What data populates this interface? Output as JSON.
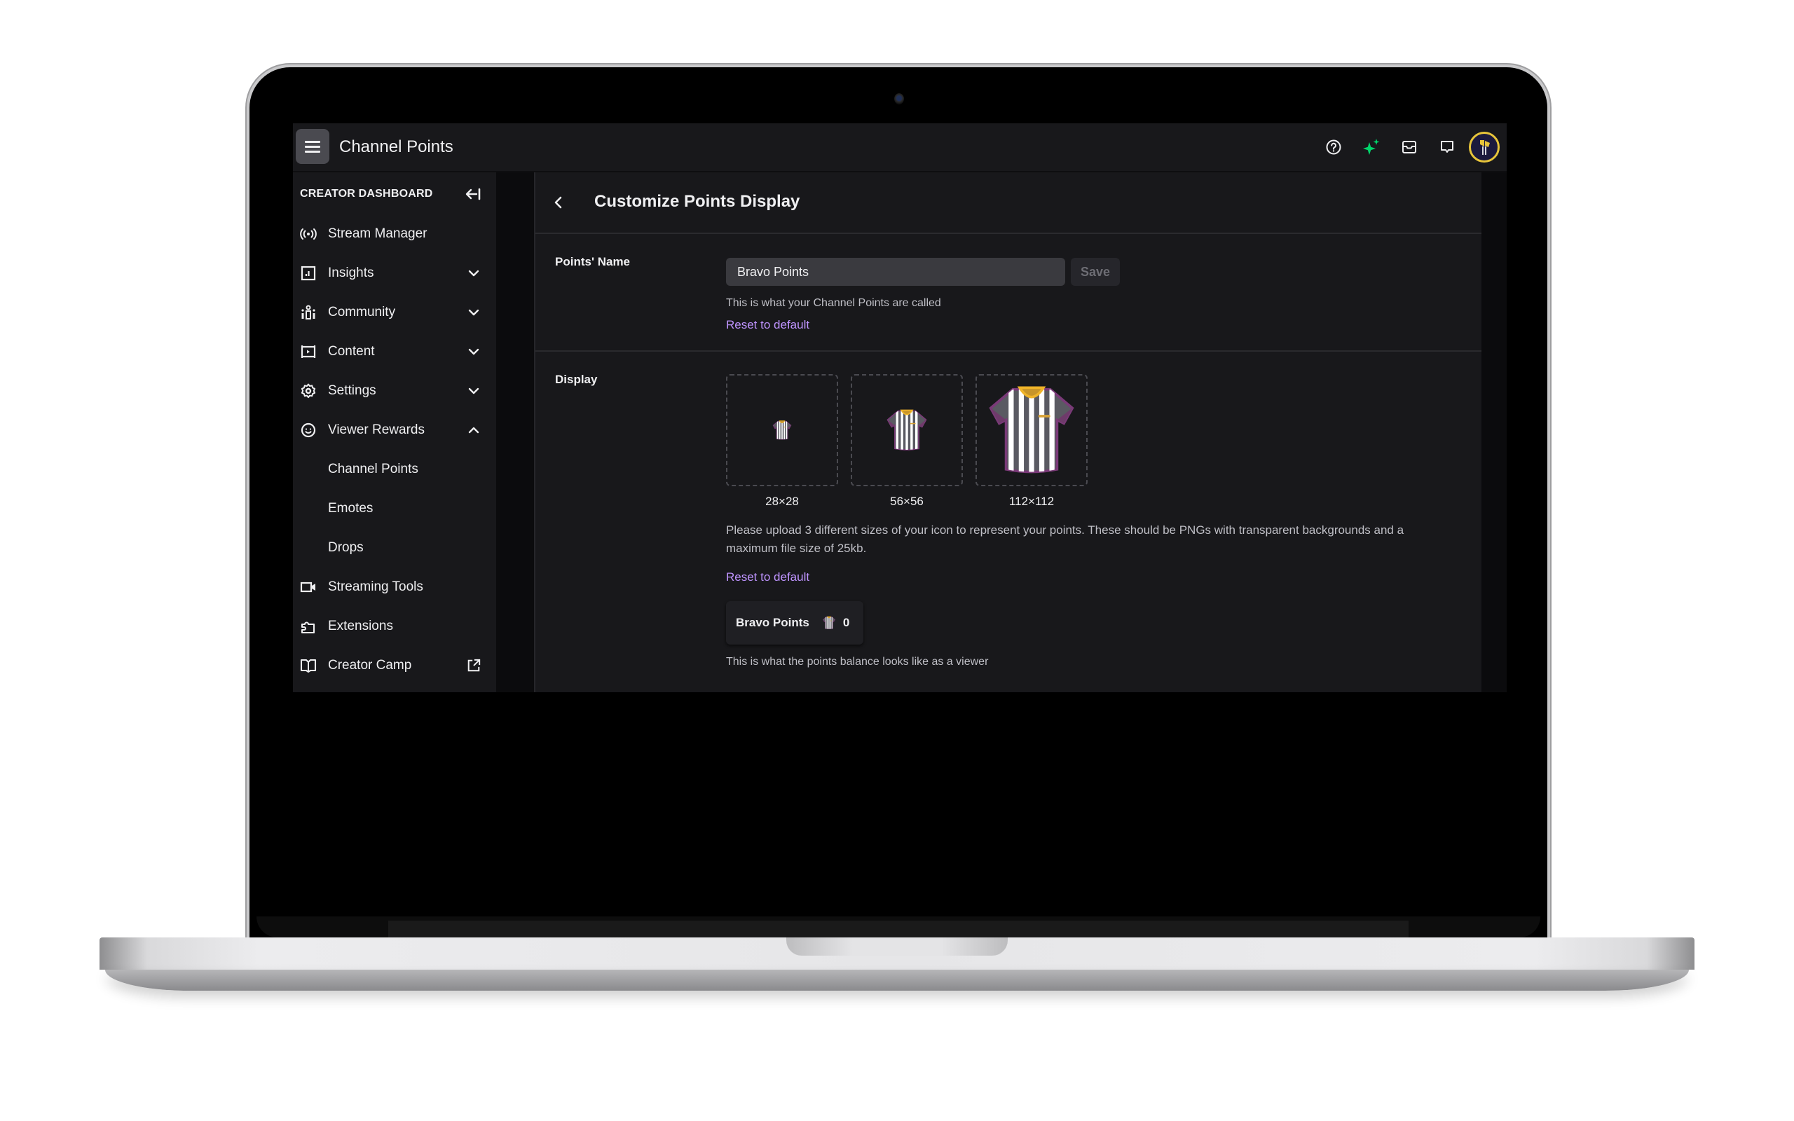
{
  "topnav": {
    "title": "Channel Points",
    "icons": [
      "help-icon",
      "sparkle-icon",
      "inbox-icon",
      "whispers-icon",
      "avatar"
    ],
    "sparkle_color": "#00d56a"
  },
  "sidebar": {
    "header": "CREATOR DASHBOARD",
    "collapse_icon": "collapse-left-icon",
    "items": [
      {
        "label": "Stream Manager",
        "icon": "broadcast-icon",
        "expandable": false
      },
      {
        "label": "Insights",
        "icon": "insights-icon",
        "expandable": true,
        "expanded": false
      },
      {
        "label": "Community",
        "icon": "community-icon",
        "expandable": true,
        "expanded": false
      },
      {
        "label": "Content",
        "icon": "content-icon",
        "expandable": true,
        "expanded": false
      },
      {
        "label": "Settings",
        "icon": "settings-icon",
        "expandable": true,
        "expanded": false
      },
      {
        "label": "Viewer Rewards",
        "icon": "viewer-rewards-icon",
        "expandable": true,
        "expanded": true,
        "children": [
          {
            "label": "Channel Points",
            "active": true
          },
          {
            "label": "Emotes"
          },
          {
            "label": "Drops"
          }
        ]
      },
      {
        "label": "Streaming Tools",
        "icon": "camera-icon",
        "expandable": false
      },
      {
        "label": "Extensions",
        "icon": "puzzle-icon",
        "expandable": false
      },
      {
        "label": "Creator Camp",
        "icon": "book-icon",
        "expandable": false,
        "external": true
      }
    ]
  },
  "main": {
    "title": "Customize Points Display",
    "points_name": {
      "label": "Points' Name",
      "value": "Bravo Points",
      "save_label": "Save",
      "helper": "This is what your Channel Points are called",
      "reset_label": "Reset to default"
    },
    "display": {
      "label": "Display",
      "icons": [
        {
          "caption": "28×28"
        },
        {
          "caption": "56×56"
        },
        {
          "caption": "112×112"
        }
      ],
      "upload_text": "Please upload 3 different sizes of your icon to represent your points. These should be PNGs with transparent backgrounds and a maximum file size of 25kb.",
      "reset_label": "Reset to default",
      "preview": {
        "name": "Bravo Points",
        "balance": "0",
        "caption": "This is what the points balance looks like as a viewer"
      }
    },
    "link_color": "#bf94ff"
  }
}
